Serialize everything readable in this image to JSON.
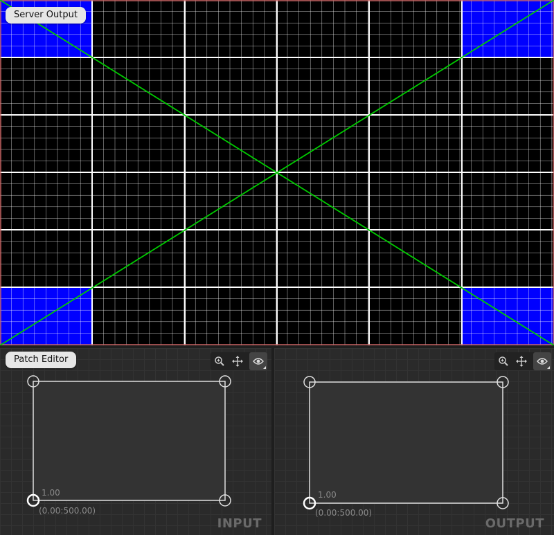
{
  "server_output": {
    "label": "Server Output",
    "colors": {
      "background": "#000000",
      "grid": "#ffffff",
      "corner_fill": "#0000ff",
      "diagonal": "#00cc00",
      "border": "#cc6666"
    }
  },
  "patch_editor": {
    "label": "Patch Editor",
    "input": {
      "pane_label": "INPUT",
      "value": "1.00",
      "coordinate": "(0.00:500.00)"
    },
    "output": {
      "pane_label": "OUTPUT",
      "value": "1.00",
      "coordinate": "(0.00:500.00)"
    },
    "toolbar_icons": [
      "zoom-icon",
      "pan-icon",
      "eye-icon"
    ]
  }
}
